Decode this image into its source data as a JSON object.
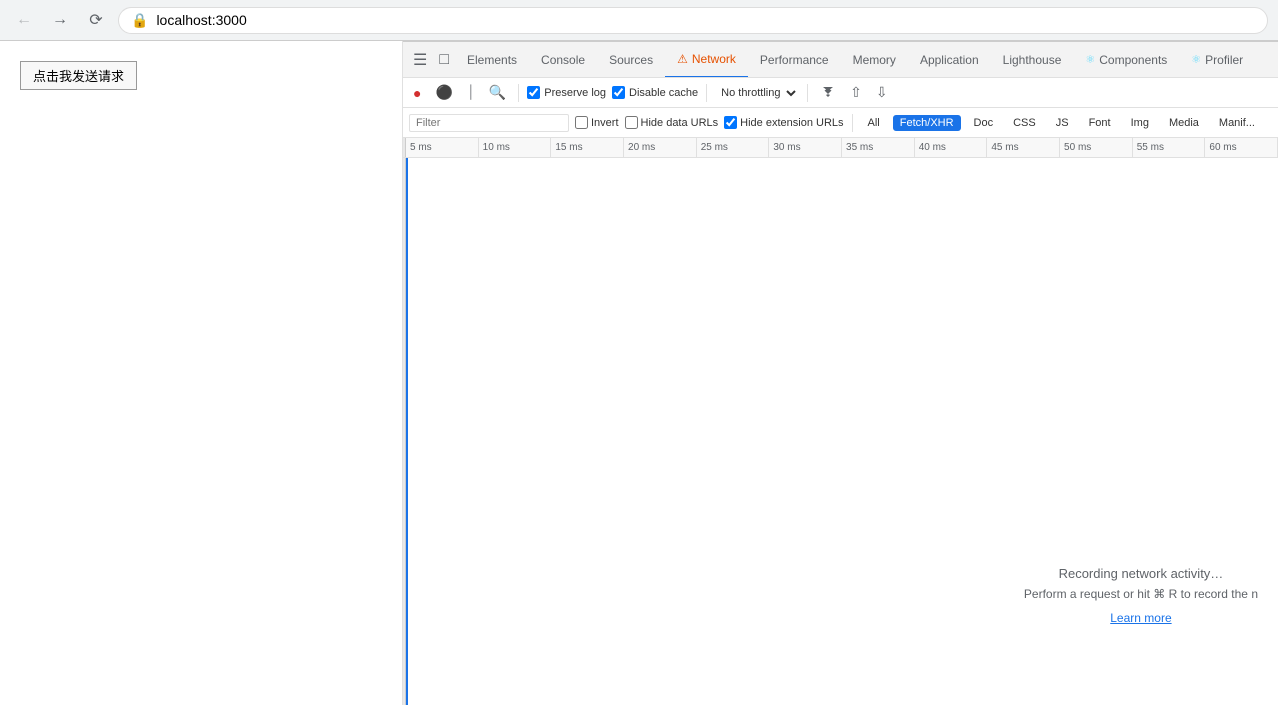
{
  "browser": {
    "address": "localhost:3000"
  },
  "page": {
    "button_label": "点击我发送请求"
  },
  "devtools": {
    "tabs": [
      {
        "id": "elements",
        "label": "Elements",
        "active": false,
        "warning": false
      },
      {
        "id": "console",
        "label": "Console",
        "active": false,
        "warning": false
      },
      {
        "id": "sources",
        "label": "Sources",
        "active": false,
        "warning": false
      },
      {
        "id": "network",
        "label": "Network",
        "active": true,
        "warning": true
      },
      {
        "id": "performance",
        "label": "Performance",
        "active": false,
        "warning": false
      },
      {
        "id": "memory",
        "label": "Memory",
        "active": false,
        "warning": false
      },
      {
        "id": "application",
        "label": "Application",
        "active": false,
        "warning": false
      },
      {
        "id": "lighthouse",
        "label": "Lighthouse",
        "active": false,
        "warning": false
      },
      {
        "id": "components",
        "label": "Components",
        "active": false,
        "warning": false
      },
      {
        "id": "profiler",
        "label": "Profiler",
        "active": false,
        "warning": false
      }
    ],
    "toolbar": {
      "preserve_log_label": "Preserve log",
      "preserve_log_checked": true,
      "disable_cache_label": "Disable cache",
      "disable_cache_checked": true,
      "throttle_label": "No throttling"
    },
    "filter": {
      "placeholder": "Filter",
      "invert_label": "Invert",
      "invert_checked": false,
      "hide_data_urls_label": "Hide data URLs",
      "hide_data_urls_checked": false,
      "hide_extension_urls_label": "Hide extension URLs",
      "hide_extension_urls_checked": true,
      "type_buttons": [
        {
          "id": "all",
          "label": "All",
          "active": false
        },
        {
          "id": "fetch-xhr",
          "label": "Fetch/XHR",
          "active": true
        },
        {
          "id": "doc",
          "label": "Doc",
          "active": false
        },
        {
          "id": "css",
          "label": "CSS",
          "active": false
        },
        {
          "id": "js",
          "label": "JS",
          "active": false
        },
        {
          "id": "font",
          "label": "Font",
          "active": false
        },
        {
          "id": "img",
          "label": "Img",
          "active": false
        },
        {
          "id": "media",
          "label": "Media",
          "active": false
        },
        {
          "id": "manifest",
          "label": "Manif...",
          "active": false
        }
      ]
    },
    "timeline": {
      "ticks": [
        "5 ms",
        "10 ms",
        "15 ms",
        "20 ms",
        "25 ms",
        "30 ms",
        "35 ms",
        "40 ms",
        "45 ms",
        "50 ms",
        "55 ms",
        "60 ms"
      ]
    },
    "empty_state": {
      "main": "Recording network activity…",
      "sub": "Perform a request or hit ⌘ R to record the n",
      "link": "Learn more"
    }
  }
}
